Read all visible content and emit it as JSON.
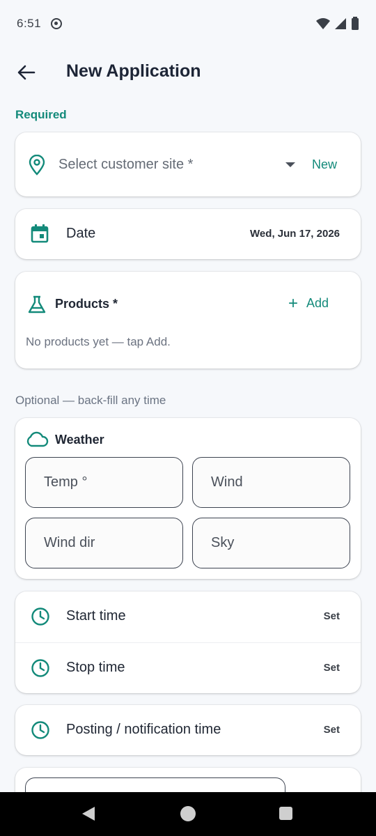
{
  "status_bar": {
    "time": "6:51",
    "icons": [
      "notification-icon",
      "wifi-icon",
      "signal-icon",
      "battery-icon"
    ]
  },
  "app_bar": {
    "title": "New Application",
    "back_icon": "arrow-left-icon"
  },
  "sections": {
    "required": "Required",
    "optional": "Optional — back-fill any time"
  },
  "customer": {
    "placeholder": "Select customer site *",
    "new_label": "New",
    "icon": "location-pin-icon"
  },
  "date": {
    "label": "Date",
    "value": "Wed, Jun 17, 2026",
    "icon": "calendar-icon"
  },
  "products": {
    "title": "Products *",
    "add_label": "Add",
    "empty_text": "No products yet — tap Add.",
    "icon": "flask-icon"
  },
  "weather": {
    "title": "Weather",
    "icon": "cloud-icon",
    "fields": {
      "temp": "Temp °",
      "wind": "Wind",
      "wind_dir": "Wind dir",
      "sky": "Sky"
    }
  },
  "times": {
    "start_label": "Start time",
    "stop_label": "Stop time",
    "posting_label": "Posting / notification time",
    "set_label": "Set",
    "icon": "clock-icon"
  },
  "colors": {
    "accent": "#138a7a",
    "background": "#f6f8fb",
    "card": "#ffffff"
  }
}
